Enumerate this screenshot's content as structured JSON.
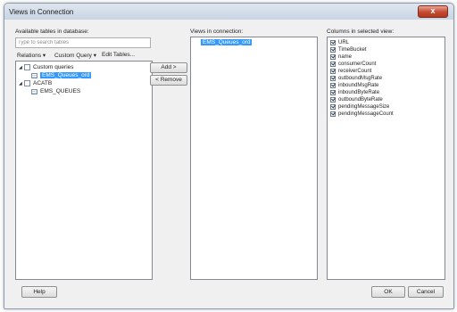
{
  "window": {
    "title": "Views in Connection",
    "close_glyph": "x"
  },
  "left": {
    "label": "Available tables in database:",
    "search_placeholder": "Type to search tables",
    "menu": {
      "relations": "Relations",
      "custom_query": "Custom Query",
      "edit_tables": "Edit Tables...",
      "dropdown_glyph": "▾"
    },
    "tree": [
      {
        "label": "Custom queries",
        "expand_glyph": "◢"
      },
      {
        "label": "EMS_Queues_ord"
      },
      {
        "label": "ACATB",
        "expand_glyph": "◢"
      },
      {
        "label": "EMS_QUEUES"
      }
    ]
  },
  "buttons": {
    "add": "Add >",
    "remove": "< Remove",
    "help": "Help",
    "ok": "OK",
    "cancel": "Cancel"
  },
  "middle": {
    "label": "Views in connection:",
    "items": [
      "EMS_Queues_ord"
    ]
  },
  "right": {
    "label": "Columns in selected view:",
    "columns": [
      "URL",
      "TimeBucket",
      "name",
      "consumerCount",
      "receiverCount",
      "outboundMsgRate",
      "inboundMsgRate",
      "inboundByteRate",
      "outboundByteRate",
      "pendingMessageSize",
      "pendingMessageCount"
    ]
  }
}
